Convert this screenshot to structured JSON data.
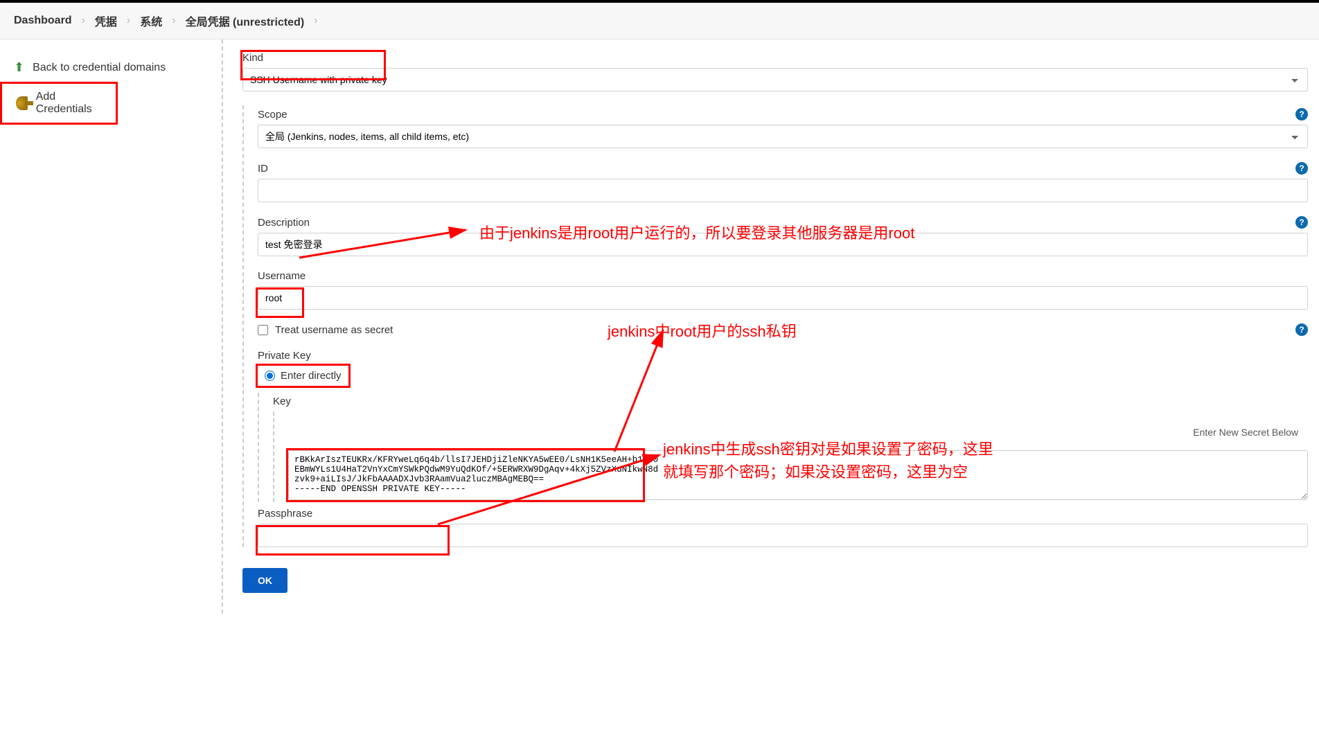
{
  "breadcrumb": {
    "items": [
      "Dashboard",
      "凭据",
      "系统",
      "全局凭据 (unrestricted)"
    ]
  },
  "sidebar": {
    "back_label": "Back to credential domains",
    "add_label": "Add Credentials"
  },
  "form": {
    "kind_label": "Kind",
    "kind_value": "SSH Username with private key",
    "scope_label": "Scope",
    "scope_value": "全局 (Jenkins, nodes, items, all child items, etc)",
    "id_label": "ID",
    "id_value": "",
    "description_label": "Description",
    "description_value": "test 免密登录",
    "username_label": "Username",
    "username_value": "root",
    "treat_secret_label": "Treat username as secret",
    "private_key_label": "Private Key",
    "enter_directly_label": "Enter directly",
    "key_sub_label": "Key",
    "key_hint": "Enter New Secret Below",
    "key_text": "rBKkArIszTEUKRx/KFRYweLq6q4b/llsI7JEHDjiZleNKYA5wEE0/LsNH1K5eeAH+b1J30\nEBmWYLs1U4HaT2VnYxCmYSWkPQdwM9YuQdKOf/+5ERWRXW9DgAqv+4kXj5ZVzXuNIkwN8d\nzvk9+aiLIsJ/JkFbAAAADXJvb3RAamVua2luczMBAgMEBQ==\n-----END OPENSSH PRIVATE KEY-----",
    "passphrase_label": "Passphrase",
    "passphrase_value": "",
    "ok_label": "OK"
  },
  "annotations": {
    "anno1": "由于jenkins是用root用户运行的，所以要登录其他服务器是用root",
    "anno2": "jenkins中root用户的ssh私钥",
    "anno3": "jenkins中生成ssh密钥对是如果设置了密码，这里就填写那个密码；如果没设置密码，这里为空"
  }
}
